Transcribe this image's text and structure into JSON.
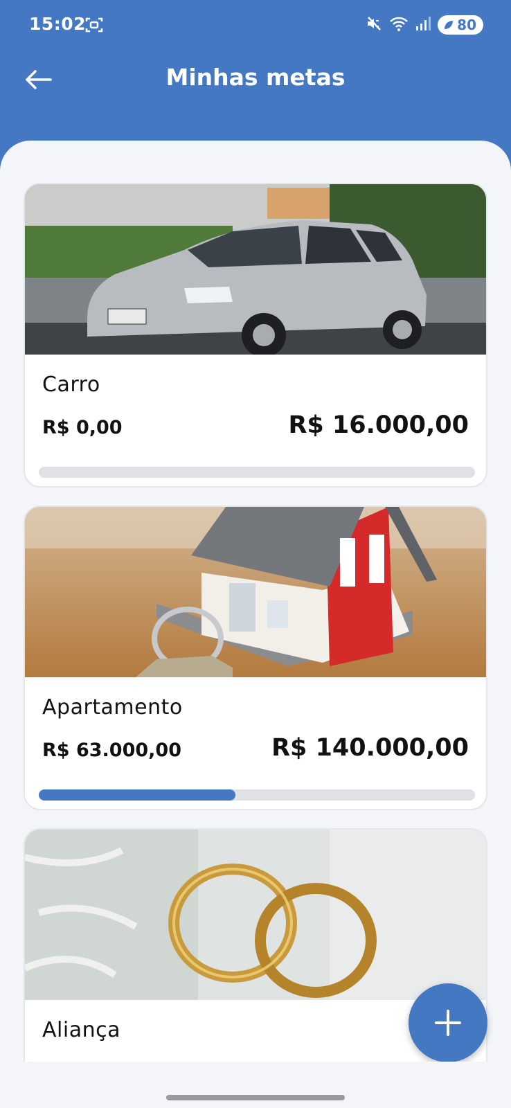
{
  "status_bar": {
    "time": "15:02",
    "battery": "80"
  },
  "header": {
    "title": "Minhas metas",
    "back_icon": "arrow-left-icon"
  },
  "colors": {
    "primary": "#4578c2",
    "track": "#dfe1e4",
    "background": "#f3f5f8"
  },
  "goals": [
    {
      "name": "Carro",
      "saved": "R$ 0,00",
      "target": "R$ 16.000,00",
      "progress": 0.0,
      "image": "silver-hatchback-car-photo"
    },
    {
      "name": "Apartamento",
      "saved": "R$ 63.000,00",
      "target": "R$ 140.000,00",
      "progress": 0.45,
      "image": "toy-house-with-keys-photo"
    },
    {
      "name": "Aliança",
      "saved": "",
      "target": "",
      "progress": null,
      "image": "gold-wedding-rings-photo"
    }
  ],
  "fab": {
    "icon": "plus-icon"
  }
}
